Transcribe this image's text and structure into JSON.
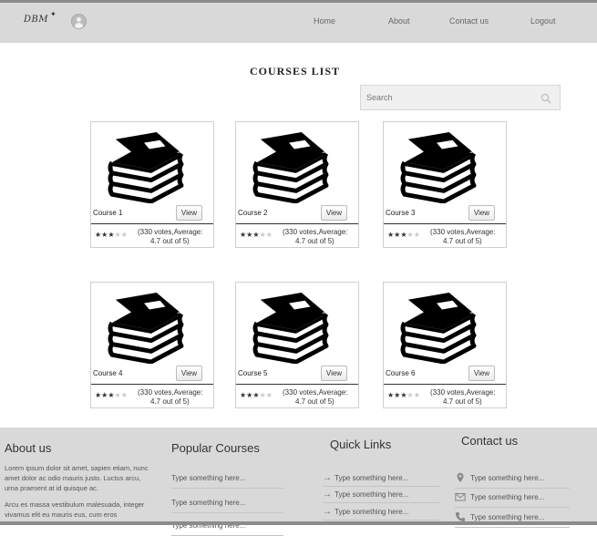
{
  "header": {
    "logo_text": "DBM",
    "nav": [
      "Home",
      "About",
      "Contact us",
      "Logout"
    ]
  },
  "page_title": "COURSES LIST",
  "search": {
    "placeholder": "Search",
    "value": ""
  },
  "courses": [
    {
      "name": "Course 1",
      "view_label": "View",
      "stars_filled": 3,
      "stars_total": 5,
      "rating_line1": "(330 votes,Average:",
      "rating_line2": "4.7 out of 5)"
    },
    {
      "name": "Course 2",
      "view_label": "View",
      "stars_filled": 3,
      "stars_total": 5,
      "rating_line1": "(330 votes,Average:",
      "rating_line2": "4.7 out of 5)"
    },
    {
      "name": "Course 3",
      "view_label": "View",
      "stars_filled": 3,
      "stars_total": 5,
      "rating_line1": "(330 votes,Average:",
      "rating_line2": "4.7 out of 5)"
    },
    {
      "name": "Course 4",
      "view_label": "View",
      "stars_filled": 3,
      "stars_total": 5,
      "rating_line1": "(330 votes,Average:",
      "rating_line2": "4.7 out of 5)"
    },
    {
      "name": "Course 5",
      "view_label": "View",
      "stars_filled": 3,
      "stars_total": 5,
      "rating_line1": "(330 votes,Average:",
      "rating_line2": "4.7 out of 5)"
    },
    {
      "name": "Course 6",
      "view_label": "View",
      "stars_filled": 3,
      "stars_total": 5,
      "rating_line1": "(330 votes,Average:",
      "rating_line2": "4.7 out of 5)"
    }
  ],
  "footer": {
    "about": {
      "title": "About us",
      "para1": "Lorem ipsum dolor sit amet, sapien etiam, nunc amet dolor ac odio mauris justo. Luctus arcu, urna praesent at id quisque ac.",
      "para2": "Arcu es massa vestibulum malesuada, integer vivamus elit eu mauris eus, cum eros"
    },
    "popular": {
      "title": "Popular Courses",
      "links": [
        "Type something here...",
        "Type something here...",
        "Type something here..."
      ]
    },
    "quick": {
      "title": "Quick Links",
      "links": [
        "Type something here...",
        "Type something here...",
        "Type something here..."
      ]
    },
    "contact": {
      "title": "Contact us",
      "items": [
        {
          "icon": "location-pin-icon",
          "text": "Type something here..."
        },
        {
          "icon": "envelope-icon",
          "text": "Type something here..."
        },
        {
          "icon": "phone-icon",
          "text": "Type something here..."
        }
      ]
    }
  }
}
